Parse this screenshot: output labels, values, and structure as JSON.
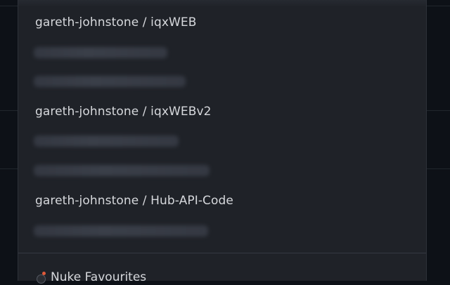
{
  "menu": {
    "repos": [
      {
        "label": "gareth-johnstone / iqxWEB"
      },
      {
        "label": "gareth-johnstone / iqxWEBv2"
      },
      {
        "label": "gareth-johnstone / Hub-API-Code"
      }
    ],
    "nuke_label": "Nuke Favourites",
    "nuke_icon": "bomb-icon"
  },
  "colors": {
    "page_background": "#0d1117",
    "panel_background": "#1f2228",
    "text": "#d6d8dc",
    "divider": "#353942"
  }
}
